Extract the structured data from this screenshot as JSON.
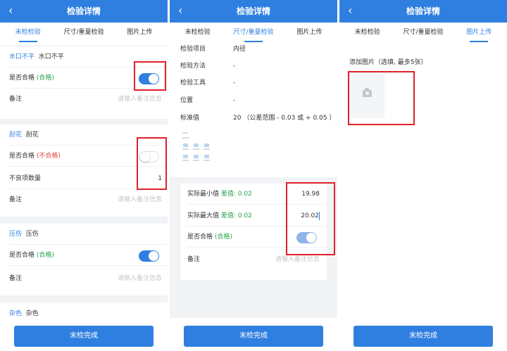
{
  "common": {
    "back_icon": "chevron-left-icon",
    "nav_title": "检验详情",
    "tabs": [
      "末检检验",
      "尺寸/重量检验",
      "图片上传"
    ],
    "complete_label": "末检完成",
    "remark_label": "备注",
    "remark_placeholder": "请输入备注信息"
  },
  "colors": {
    "accent": "#2f7fe0",
    "pass": "#22a34a",
    "fail": "#e0413a",
    "highlight": "#e0202a"
  },
  "panel1": {
    "items": [
      {
        "code": "水口不平",
        "name": "水口不平",
        "qualified_label": "是否合格",
        "status": "(合格)",
        "toggle_on": true
      },
      {
        "code": "刮花",
        "name": "刮花",
        "qualified_label": "是否合格",
        "status": "(不合格)",
        "toggle_on": false,
        "defect_label": "不良项数量",
        "defect_count": "1"
      },
      {
        "code": "压伤",
        "name": "压伤",
        "qualified_label": "是否合格",
        "status": "(合格)",
        "toggle_on": true
      },
      {
        "code": "杂色",
        "name": "杂色"
      }
    ]
  },
  "panel2": {
    "fields": [
      {
        "label": "检验项目",
        "value": "内径"
      },
      {
        "label": "检验方法",
        "value": "-"
      },
      {
        "label": "检验工具",
        "value": "-"
      },
      {
        "label": "位置",
        "value": "-"
      },
      {
        "label": "标准值",
        "value": "20 （公差范围 - 0.03 或 + 0.05 ）"
      }
    ],
    "min_label": "实际最小值",
    "min_diff": "差值: 0.02",
    "min_value": "19.98",
    "max_label": "实际最大值",
    "max_diff": "差值: 0.02",
    "max_value": "20.02",
    "qualified_label": "是否合格",
    "qualified_status": "(合格)"
  },
  "panel3": {
    "add_image_label": "添加图片（选填, 最多5张）",
    "camera_icon": "camera-icon"
  }
}
